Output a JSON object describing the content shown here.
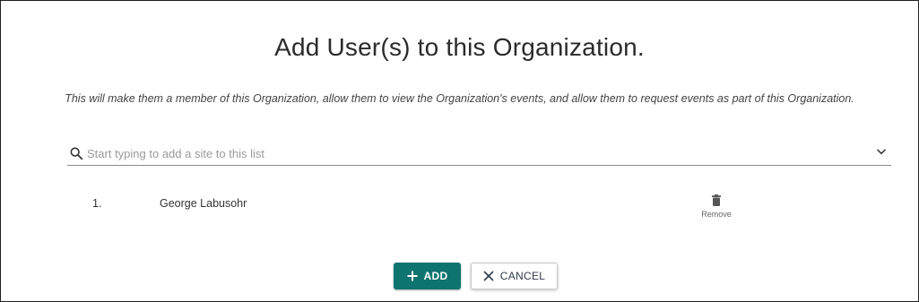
{
  "dialog": {
    "title": "Add User(s) to this Organization.",
    "subtitle": "This will make them a member of this Organization, allow them to view the Organization's events, and allow them to request events as part of this Organization."
  },
  "search": {
    "placeholder": "Start typing to add a site to this list",
    "value": "",
    "icon": "search-icon",
    "dropdown_icon": "chevron-down-icon"
  },
  "users": [
    {
      "number": "1.",
      "name": "George Labusohr",
      "remove_label": "Remove",
      "remove_icon": "trash-icon"
    }
  ],
  "actions": {
    "add_label": "ADD",
    "add_icon": "plus-icon",
    "cancel_label": "CANCEL",
    "cancel_icon": "close-icon"
  },
  "colors": {
    "primary": "#0e7470",
    "text": "#333333",
    "muted": "#9a9a9a"
  }
}
